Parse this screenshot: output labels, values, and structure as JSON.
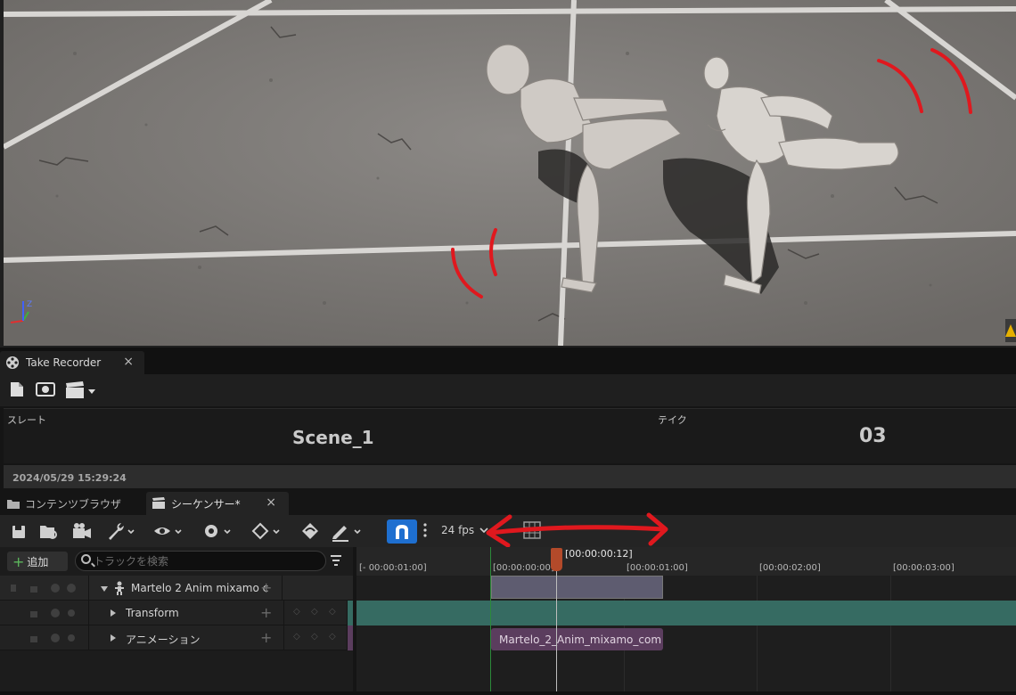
{
  "viewport": {
    "warning_icon": "warning-triangle-icon",
    "axis_gizmo": "xyz-axis-gizmo-icon"
  },
  "take_recorder": {
    "tab_label": "Take Recorder",
    "close": "×",
    "slate_label": "スレート",
    "slate_value": "Scene_1",
    "take_label": "テイク",
    "take_value": "03",
    "timestamp": "2024/05/29 15:29:24"
  },
  "tabs": {
    "content_browser": "コンテンツブラウザ",
    "sequencer": "シーケンサー*",
    "close": "×"
  },
  "sequencer_toolbar": {
    "fps": "24 fps",
    "icons": [
      "save-icon",
      "browse-icon",
      "camera-icon",
      "wrench-icon",
      "eye-icon",
      "settings-icon",
      "keyframe-icon",
      "key-curve-icon",
      "pencil-icon",
      "magnet-icon",
      "grid-icon"
    ]
  },
  "tracks": {
    "add_label": "追加",
    "search_placeholder": "トラックを検索",
    "rows": [
      {
        "label": "Martelo 2 Anim mixamo c"
      },
      {
        "label": "Transform"
      },
      {
        "label": "アニメーション"
      }
    ]
  },
  "timeline": {
    "current_time": "[00:00:00:12]",
    "ticks": [
      "[- 00:00:01:00]",
      "[00:00:00:00]",
      "[00:00:01:00]",
      "[00:00:02:00]",
      "[00:00:03:00]"
    ],
    "clip_label": "Martelo_2_Anim_mixamo_com"
  },
  "annotation_color": "#e0181e"
}
